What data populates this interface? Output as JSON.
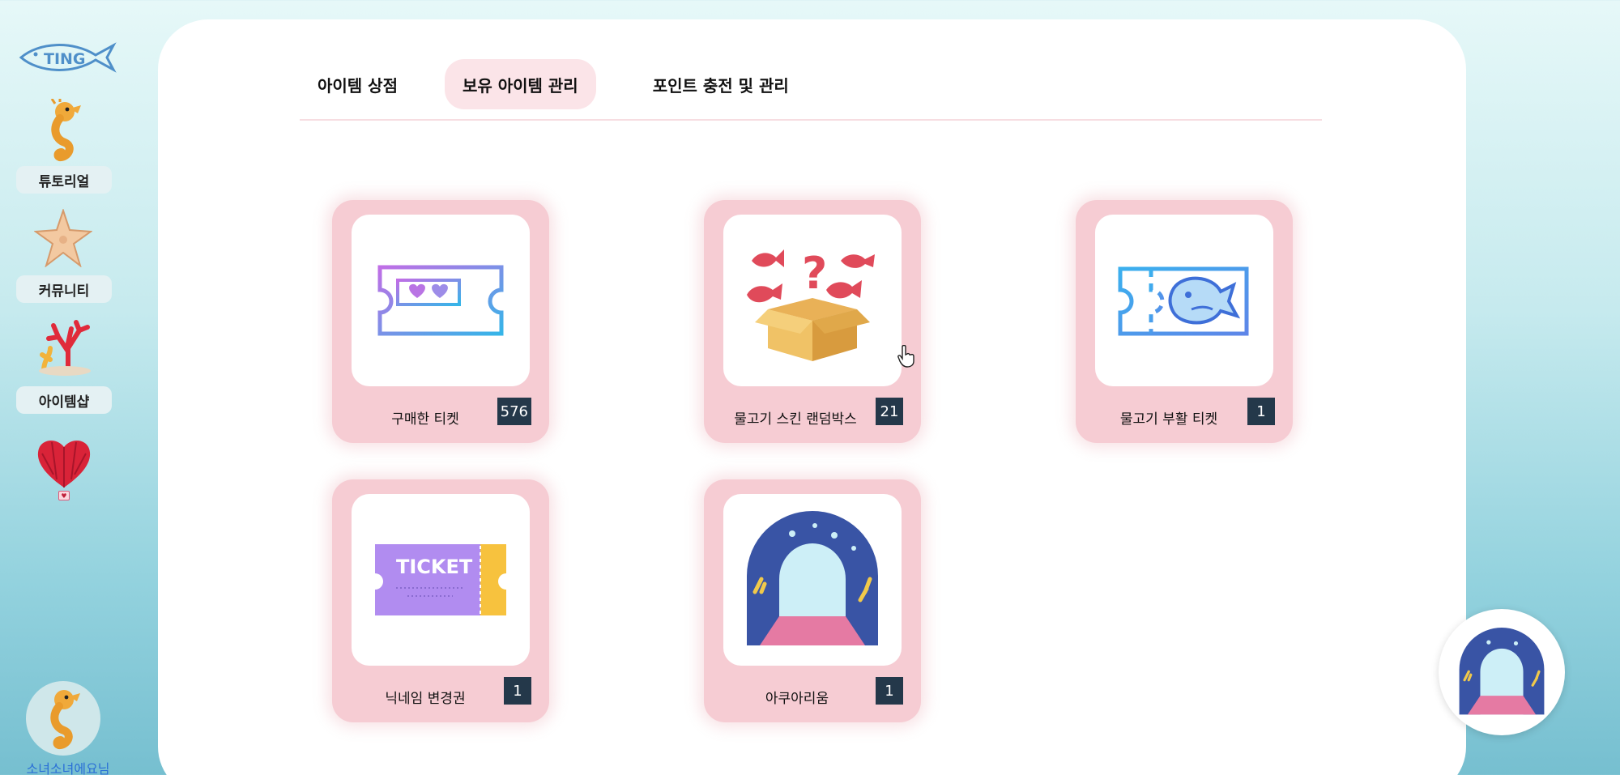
{
  "sidebar": {
    "logo_text": "TING",
    "items": [
      {
        "label": "튜토리얼",
        "icon": "seahorse-icon"
      },
      {
        "label": "커뮤니티",
        "icon": "starfish-icon"
      },
      {
        "label": "아이템샵",
        "icon": "coral-icon"
      },
      {
        "label": "♥",
        "icon": "heart-lantern-icon"
      }
    ],
    "profile": {
      "name": "소녀소녀에요님",
      "avatar_icon": "seahorse-icon"
    }
  },
  "tabs": [
    {
      "label": "아이템 상점",
      "active": false
    },
    {
      "label": "보유 아이템 관리",
      "active": true
    },
    {
      "label": "포인트 충전 및 관리",
      "active": false
    }
  ],
  "items": [
    {
      "name": "구매한 티켓",
      "count": "576",
      "icon": "heart-ticket-icon"
    },
    {
      "name": "물고기 스킨 랜덤박스",
      "count": "21",
      "icon": "fish-random-box-icon"
    },
    {
      "name": "물고기 부활 티켓",
      "count": "1",
      "icon": "fish-ticket-icon"
    },
    {
      "name": "닉네임 변경권",
      "count": "1",
      "icon": "ticket-icon"
    },
    {
      "name": "아쿠아리움",
      "count": "1",
      "icon": "aquarium-icon"
    }
  ],
  "colors": {
    "card_bg": "#f6ccd3",
    "active_tab_bg": "#fbe4e8",
    "count_badge_bg": "#24384a",
    "profile_name": "#2a6fd6"
  },
  "floating_button": {
    "icon": "aquarium-icon"
  }
}
